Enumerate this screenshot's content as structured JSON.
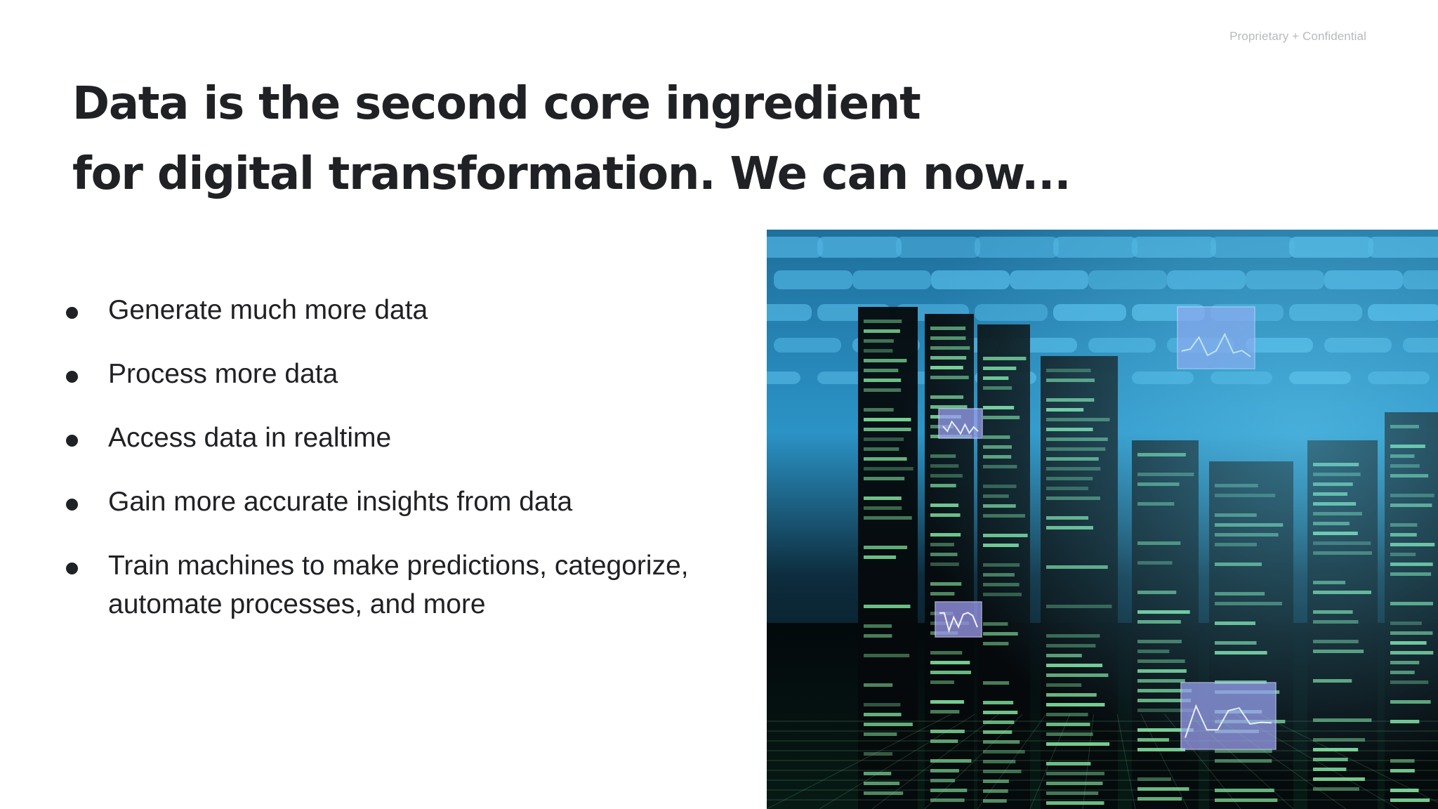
{
  "slide": {
    "confidential_label": "Proprietary + Confidential",
    "title_lines": [
      "Data is the second core ingredient",
      "for digital transformation. We can now..."
    ],
    "bullets": [
      "Generate much more data",
      "Process more data",
      "Access data in realtime",
      "Gain more accurate insights from data",
      "Train machines to make predictions, categorize, automate processes, and more"
    ]
  },
  "image": {
    "subject": "data-center-server-racks-photo",
    "colors": {
      "sky": "#4fb3e0",
      "racks": "#05090c",
      "leds": "#7fdc9a",
      "screens": "#9e9cf0"
    }
  }
}
